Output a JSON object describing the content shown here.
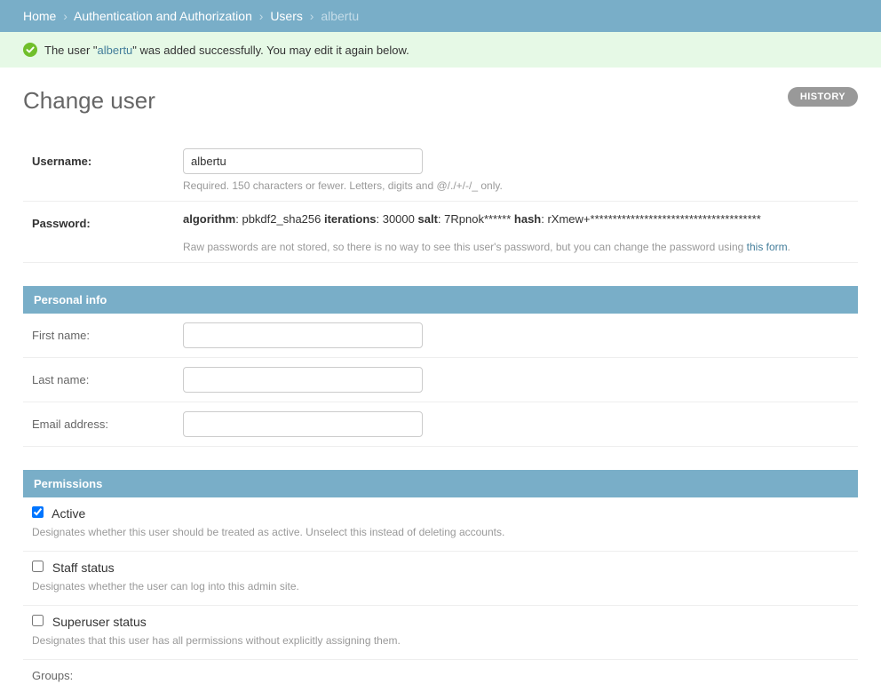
{
  "breadcrumbs": {
    "home": "Home",
    "auth": "Authentication and Authorization",
    "users": "Users",
    "current": "albertu"
  },
  "message": {
    "prefix": "The user \"",
    "username": "albertu",
    "suffix": "\" was added successfully. You may edit it again below."
  },
  "page_title": "Change user",
  "history_btn": "HISTORY",
  "fields": {
    "username": {
      "label": "Username:",
      "value": "albertu",
      "help": "Required. 150 characters or fewer. Letters, digits and @/./+/-/_ only."
    },
    "password": {
      "label": "Password:",
      "algo_key": "algorithm",
      "algo_val": ": pbkdf2_sha256 ",
      "iter_key": "iterations",
      "iter_val": ": 30000 ",
      "salt_key": "salt",
      "salt_val": ": 7Rpnok****** ",
      "hash_key": "hash",
      "hash_val": ": rXmew+**************************************",
      "help_pre": "Raw passwords are not stored, so there is no way to see this user's password, but you can change the password using ",
      "help_link": "this form",
      "help_post": "."
    }
  },
  "personal": {
    "heading": "Personal info",
    "first_name": "First name:",
    "last_name": "Last name:",
    "email": "Email address:"
  },
  "permissions": {
    "heading": "Permissions",
    "active": {
      "label": "Active",
      "help": "Designates whether this user should be treated as active. Unselect this instead of deleting accounts.",
      "checked": true
    },
    "staff": {
      "label": "Staff status",
      "help": "Designates whether the user can log into this admin site.",
      "checked": false
    },
    "superuser": {
      "label": "Superuser status",
      "help": "Designates that this user has all permissions without explicitly assigning them.",
      "checked": false
    },
    "groups_label": "Groups:"
  }
}
